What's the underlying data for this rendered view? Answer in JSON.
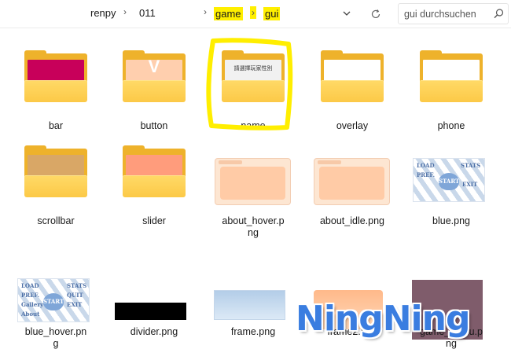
{
  "address": {
    "crumbs": [
      "renpy",
      "011",
      "game",
      "gui"
    ],
    "separator": "›",
    "highlight_color": "#ffef00"
  },
  "search": {
    "placeholder": "gui durchsuchen",
    "icon": "search-icon"
  },
  "items": [
    {
      "name": "bar",
      "kind": "folder",
      "preview": "#c8005a"
    },
    {
      "name": "button",
      "kind": "folder",
      "preview": "#ffcfae",
      "preview_text": "V"
    },
    {
      "name": "name",
      "kind": "folder",
      "preview": "#f1f1f1",
      "preview_text": "請選擇玩家性別"
    },
    {
      "name": "overlay",
      "kind": "folder",
      "preview": "#ffffff"
    },
    {
      "name": "phone",
      "kind": "folder",
      "preview": "#ffffff"
    },
    {
      "name": "scrollbar",
      "kind": "folder",
      "preview": "#d9a766"
    },
    {
      "name": "slider",
      "kind": "folder",
      "preview": "#ff9c7c"
    },
    {
      "name": "about_hover.png",
      "kind": "image"
    },
    {
      "name": "about_idle.png",
      "kind": "image"
    },
    {
      "name": "blue.png",
      "kind": "image"
    },
    {
      "name": "blue_hover.png",
      "kind": "image"
    },
    {
      "name": "divider.png",
      "kind": "image"
    },
    {
      "name": "frame.png",
      "kind": "image"
    },
    {
      "name": "frame2.png",
      "kind": "image"
    },
    {
      "name": "game_menu.png",
      "kind": "image"
    }
  ],
  "label_lines": {
    "about_hover": [
      "about_hover.p",
      "ng"
    ],
    "blue_hover": [
      "blue_hover.pn",
      "g"
    ],
    "game_menu": [
      "game_menu.p",
      "ng"
    ]
  },
  "blue_image_text": [
    "LOAD",
    "PREF.",
    "Gallery",
    "About",
    "STATS",
    "QUIT",
    "EXIT",
    "START"
  ],
  "annotation": {
    "color": "#ffee00"
  },
  "watermark": "NingNing"
}
